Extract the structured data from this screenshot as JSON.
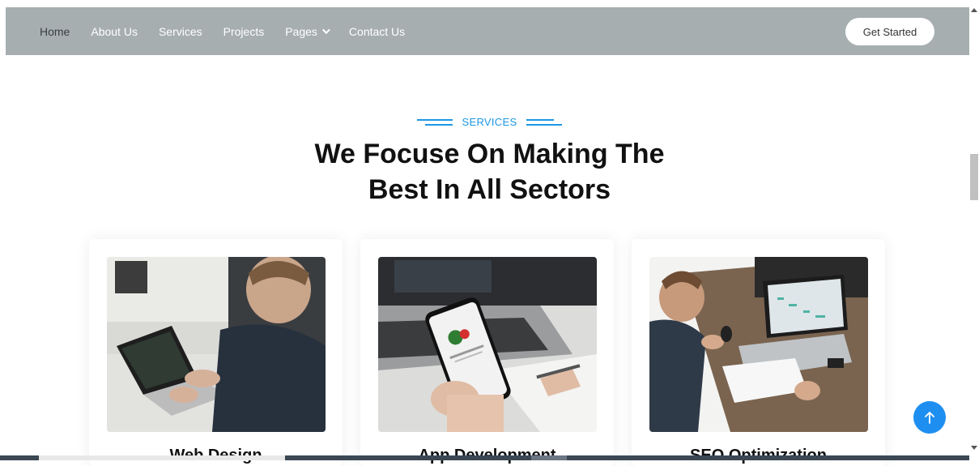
{
  "nav": {
    "links": [
      {
        "label": "Home"
      },
      {
        "label": "About Us"
      },
      {
        "label": "Services"
      },
      {
        "label": "Projects"
      },
      {
        "label": "Pages"
      },
      {
        "label": "Contact Us"
      }
    ],
    "cta": "Get Started"
  },
  "section": {
    "tag": "SERVICES",
    "heading_line1": "We Focuse On Making The",
    "heading_line2": "Best In All Sectors"
  },
  "cards": [
    {
      "title": "Web Design",
      "image": "man-laptop-photo"
    },
    {
      "title": "App Development",
      "image": "phone-app-photo"
    },
    {
      "title": "SEO Optimization",
      "image": "desk-laptop-photo"
    }
  ],
  "colors": {
    "accent": "#1e97e3",
    "navbar": "#a6aeb0",
    "back_to_top": "#1e8ff0"
  },
  "icons": {
    "back_to_top": "arrow-up-icon",
    "pages_dropdown": "chevron-down-icon"
  }
}
